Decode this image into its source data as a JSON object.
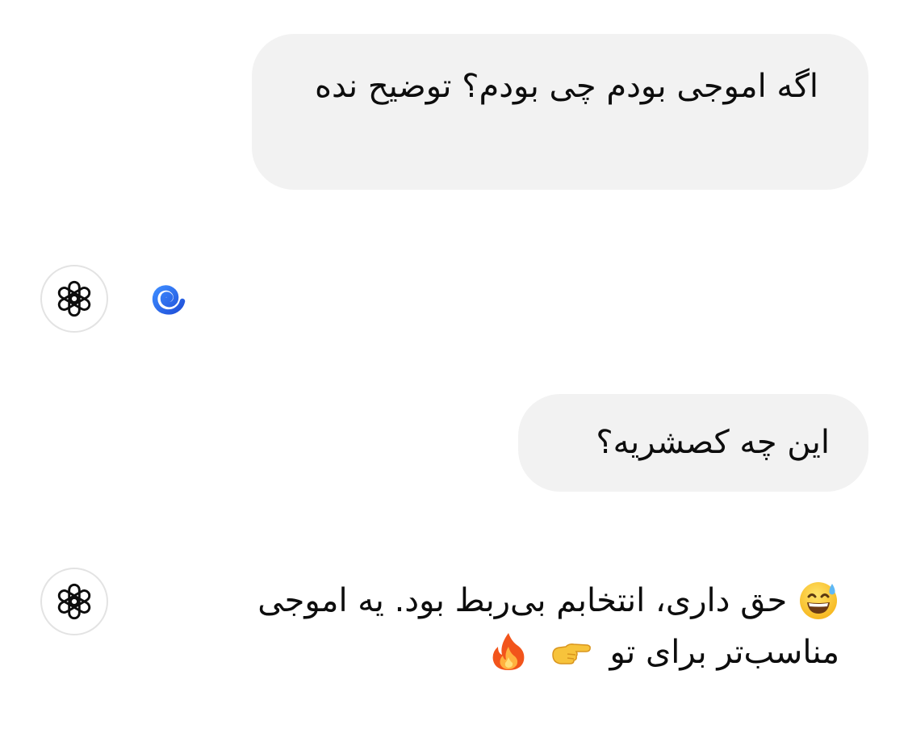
{
  "conversation": {
    "user_message_1": "اگه اموجی بودم چی بودم؟ توضیح نده",
    "assistant_reply_1": {
      "emoji": "spiral-emoji"
    },
    "user_message_2": "این چه کصشریه؟",
    "assistant_reply_2": {
      "leading_emoji": "grinning-sweat-emoji",
      "line_1": "حق داری، انتخابم بی‌ربط بود. یه اموجی",
      "line_2": "مناسب‌تر برای تو",
      "pointing_emoji": "backhand-index-pointing-right-emoji",
      "trailing_emoji": "fire-emoji"
    },
    "avatar_icon": "openai-logo-icon"
  },
  "colors": {
    "user_bubble_bg": "#f2f2f2",
    "text": "#0d0d0d",
    "avatar_border": "#e3e3e3",
    "background": "#ffffff"
  }
}
